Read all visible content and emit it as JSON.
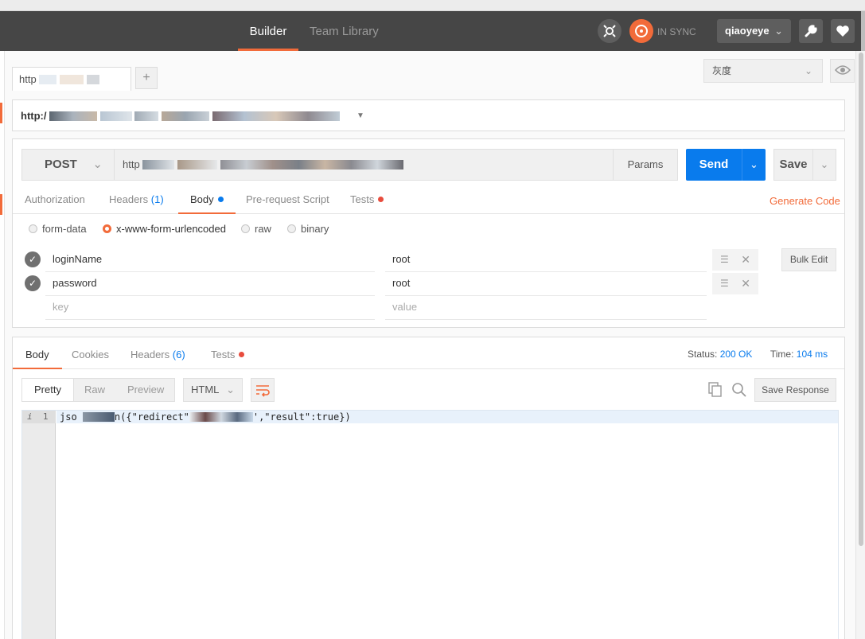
{
  "header": {
    "tab_builder": "Builder",
    "tab_team_library": "Team Library",
    "sync_status": "IN SYNC",
    "username": "qiaoyeye"
  },
  "tabs": {
    "active_tab_title": "http",
    "new_tab_label": "+"
  },
  "environment": {
    "selected": "灰度"
  },
  "url_bar": {
    "value": "http:/"
  },
  "request": {
    "method": "POST",
    "url_value": "http",
    "params_label": "Params",
    "send_label": "Send",
    "save_label": "Save",
    "tabs": {
      "authorization": "Authorization",
      "headers": "Headers",
      "headers_count": "(1)",
      "body": "Body",
      "pre_request": "Pre-request Script",
      "tests": "Tests"
    },
    "generate_code": "Generate Code",
    "body_modes": [
      "form-data",
      "x-www-form-urlencoded",
      "raw",
      "binary"
    ],
    "selected_body_mode": "x-www-form-urlencoded",
    "rows": [
      {
        "key": "loginName",
        "value": "root",
        "enabled": true
      },
      {
        "key": "password",
        "value": "root",
        "enabled": true
      }
    ],
    "key_placeholder": "key",
    "value_placeholder": "value",
    "bulk_edit": "Bulk Edit"
  },
  "response": {
    "tabs": {
      "body": "Body",
      "cookies": "Cookies",
      "headers": "Headers",
      "headers_count": "(6)",
      "tests": "Tests"
    },
    "status_label": "Status:",
    "status_value": "200 OK",
    "time_label": "Time:",
    "time_value": "104 ms",
    "view_modes": [
      "Pretty",
      "Raw",
      "Preview"
    ],
    "format": "HTML",
    "save_response": "Save Response",
    "line_info": "i",
    "line_number": "1",
    "code_start": "jso",
    "code_mid": "n({\"redirect\"",
    "code_end": "',\"result\":true})"
  },
  "colors": {
    "accent": "#f26b3a",
    "primary": "#097bed",
    "header_bg": "#464646",
    "tests_dot": "#e84c3d",
    "body_dot": "#097bed"
  },
  "icons": [
    "interceptor-icon",
    "sync-icon",
    "chevron-down-icon",
    "wrench-icon",
    "heart-icon",
    "eye-icon",
    "check-icon",
    "menu-icon",
    "close-icon",
    "wrap-lines-icon",
    "copy-icon",
    "search-icon"
  ]
}
